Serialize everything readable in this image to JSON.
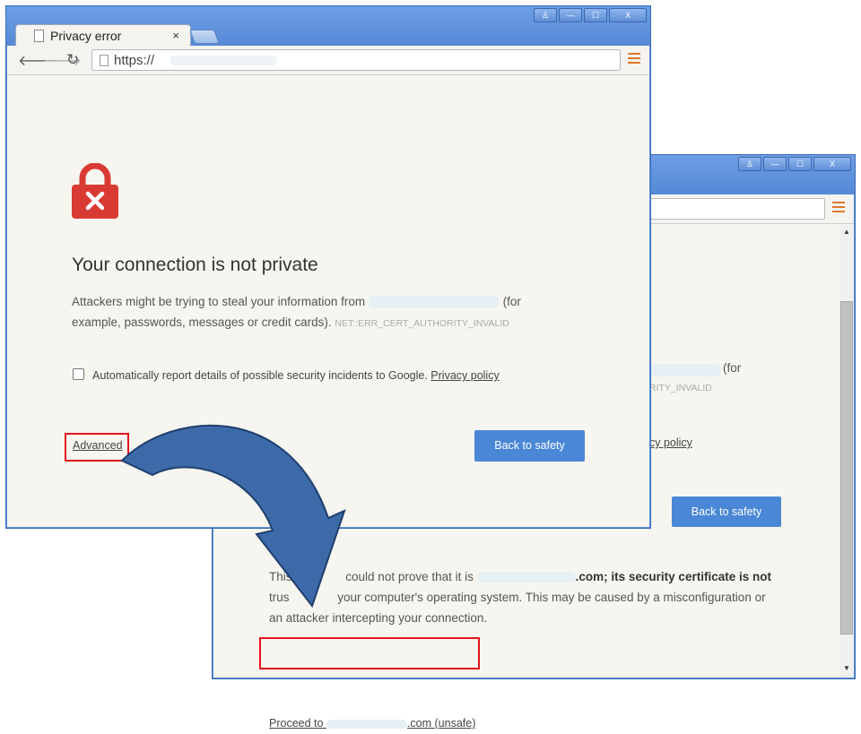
{
  "front_window": {
    "tab_title": "Privacy error",
    "tab_close": "×",
    "url": "https://",
    "heading": "Your connection is not private",
    "message_part1": "Attackers might be trying to steal your information from",
    "message_part2": "(for",
    "message_line2": "example, passwords, messages or credit cards).",
    "error_code": "NET::ERR_CERT_AUTHORITY_INVALID",
    "checkbox_label": "Automatically report details of possible security incidents to Google.",
    "privacy_link": "Privacy policy",
    "advanced_link": "Advanced",
    "back_button": "Back to safety"
  },
  "back_window": {
    "partial_for": "(for",
    "partial_errcode": "RITY_INVALID",
    "partial_privacy": "cy policy",
    "back_button": "Back to safety",
    "detail_line1_a": "This",
    "detail_line1_b": "could not prove that it is",
    "detail_line1_c": ".com; its security certificate is not",
    "detail_line2_a": "trus",
    "detail_line2_b": "your computer's operating system. This may be caused by a misconfiguration or",
    "detail_line3": "an attacker intercepting your connection.",
    "proceed_a": "Proceed to",
    "proceed_b": ".com (unsafe)"
  },
  "window_buttons": {
    "user": "♙",
    "min": "—",
    "max": "☐",
    "close": "X"
  },
  "colors": {
    "accent_button": "#4a87d6",
    "highlight": "#e0141c",
    "lock": "#d93a33",
    "arrow": "#3d6aa8"
  }
}
